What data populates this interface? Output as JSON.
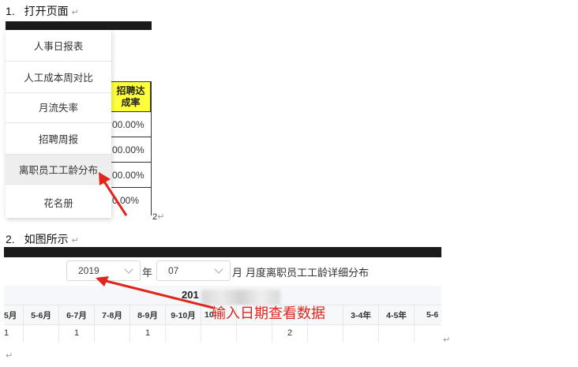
{
  "steps": {
    "step1": {
      "num": "1.",
      "title": "打开页面"
    },
    "step2": {
      "num": "2.",
      "title": "如图所示"
    }
  },
  "menu": {
    "items": [
      {
        "label": "人事日报表"
      },
      {
        "label": "人工成本周对比"
      },
      {
        "label": "月流失率"
      },
      {
        "label": "招聘周报"
      },
      {
        "label": "离职员工工龄分布"
      },
      {
        "label": "花名册"
      }
    ]
  },
  "table_fragment": {
    "header": "招聘达成率",
    "header_line1": "招聘达",
    "header_line2": "成率",
    "cells": [
      "00.00%",
      "00.00%",
      "00.00%",
      "0.00%"
    ],
    "overflow_digit": "2"
  },
  "filter": {
    "year_value": "2019",
    "year_suffix": "年",
    "month_value": "07",
    "month_suffix": "月",
    "report_title": "月度离职员工工龄详细分布"
  },
  "grid": {
    "title_prefix": "201",
    "columns": [
      "5月",
      "5-6月",
      "6-7月",
      "7-8月",
      "8-9月",
      "9-10月",
      "10",
      "",
      "",
      "",
      "3-4年",
      "4-5年",
      "5-6"
    ],
    "values": [
      "1",
      "",
      "1",
      "",
      "1",
      "",
      "",
      "",
      "2",
      "",
      "",
      "",
      ""
    ]
  },
  "annotation": {
    "text": "输入日期查看数据",
    "color": "#e0251b"
  },
  "colors": {
    "header_yellow": "#ffff3a",
    "arrow_red": "#e0251b"
  }
}
